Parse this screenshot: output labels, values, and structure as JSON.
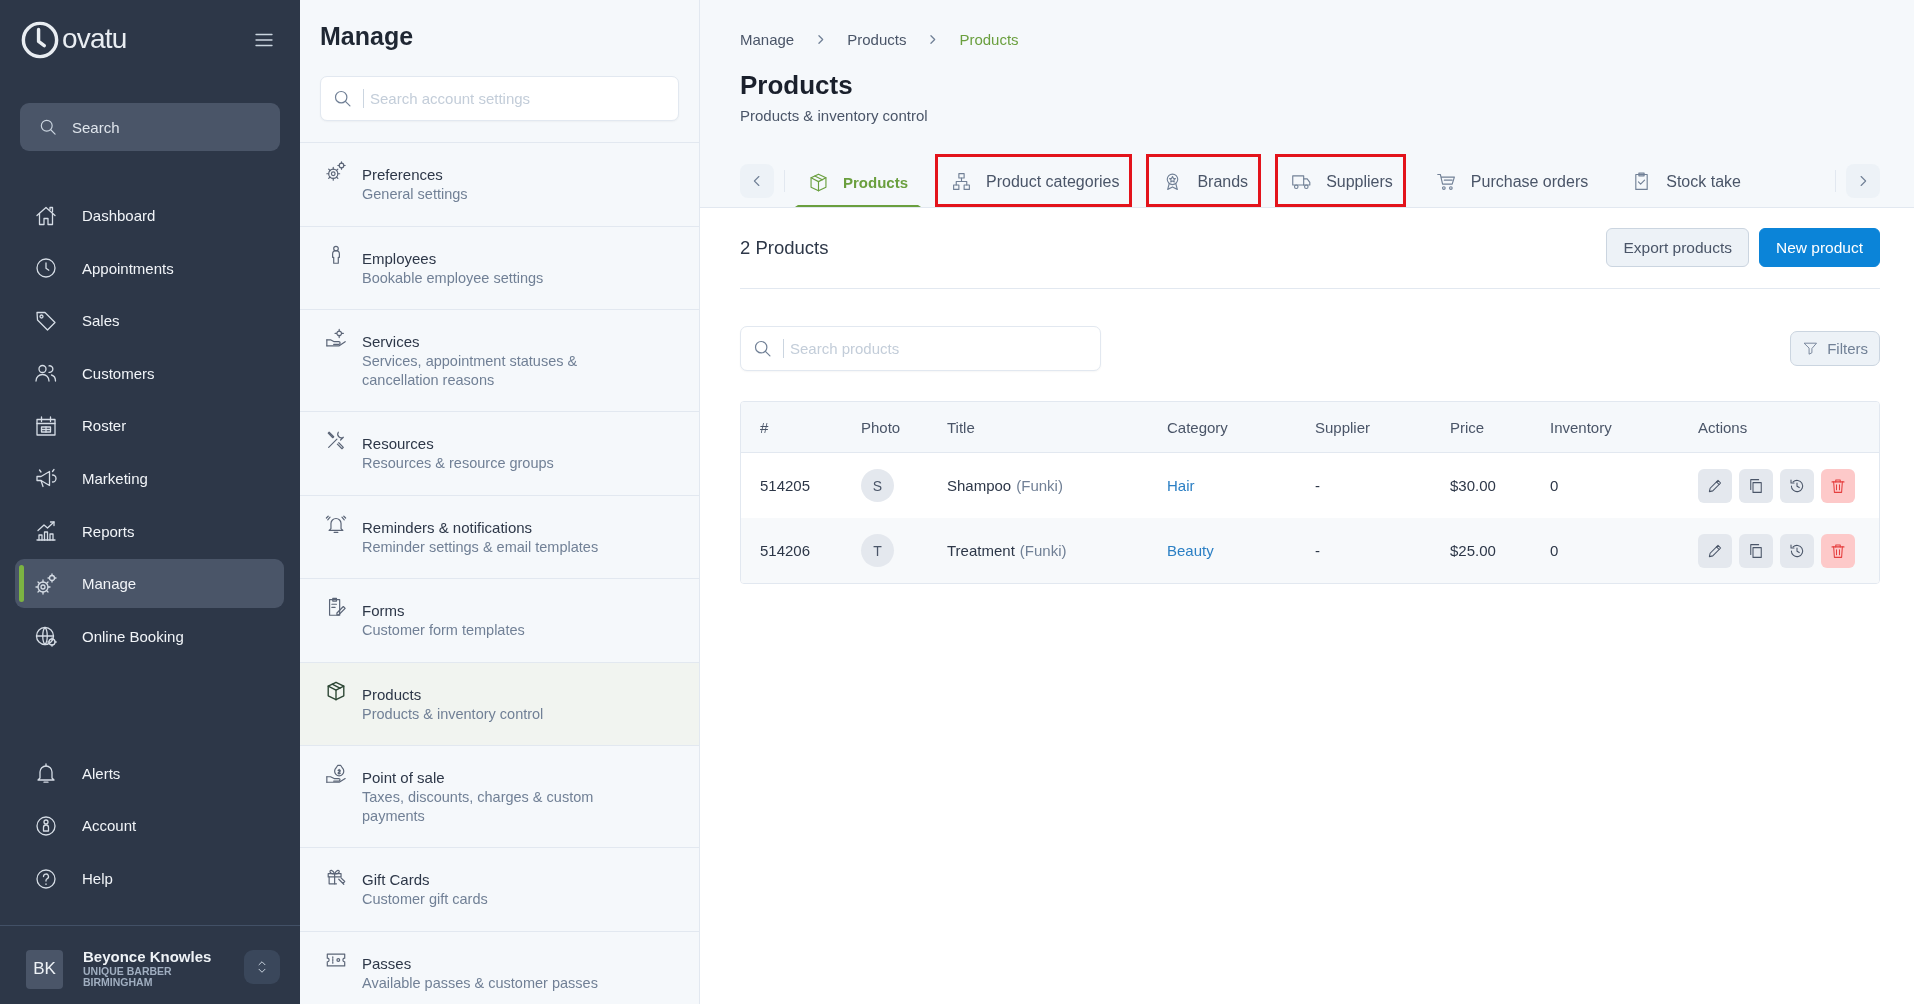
{
  "sidebar": {
    "logo": "ovatu",
    "search": {
      "placeholder": "Search"
    },
    "nav": [
      {
        "label": "Dashboard",
        "selected": false
      },
      {
        "label": "Appointments",
        "selected": false
      },
      {
        "label": "Sales",
        "selected": false
      },
      {
        "label": "Customers",
        "selected": false
      },
      {
        "label": "Roster",
        "selected": false
      },
      {
        "label": "Marketing",
        "selected": false
      },
      {
        "label": "Reports",
        "selected": false
      },
      {
        "label": "Manage",
        "selected": true
      },
      {
        "label": "Online Booking",
        "selected": false
      }
    ],
    "footer_nav": [
      {
        "label": "Alerts",
        "selected": false
      },
      {
        "label": "Account",
        "selected": false
      },
      {
        "label": "Help",
        "selected": false
      }
    ],
    "user": {
      "initials": "BK",
      "name": "Beyonce Knowles",
      "organization": "UNIQUE BARBER BIRMINGHAM"
    }
  },
  "settings_panel": {
    "title": "Manage",
    "search": {
      "placeholder": "Search account settings"
    },
    "items": [
      {
        "title": "Preferences",
        "description": "General settings",
        "selected": false
      },
      {
        "title": "Employees",
        "description": "Bookable employee settings",
        "selected": false
      },
      {
        "title": "Services",
        "description": "Services, appointment statuses & cancellation reasons",
        "selected": false
      },
      {
        "title": "Resources",
        "description": "Resources & resource groups",
        "selected": false
      },
      {
        "title": "Reminders & notifications",
        "description": "Reminder settings & email templates",
        "selected": false
      },
      {
        "title": "Forms",
        "description": "Customer form templates",
        "selected": false
      },
      {
        "title": "Products",
        "description": "Products & inventory control",
        "selected": true
      },
      {
        "title": "Point of sale",
        "description": "Taxes, discounts, charges & custom payments",
        "selected": false
      },
      {
        "title": "Gift Cards",
        "description": "Customer gift cards",
        "selected": false
      },
      {
        "title": "Passes",
        "description": "Available passes & customer passes",
        "selected": false
      }
    ]
  },
  "main": {
    "breadcrumb": [
      {
        "label": "Manage",
        "current": false
      },
      {
        "label": "Products",
        "current": false
      },
      {
        "label": "Products",
        "current": true
      }
    ],
    "title": "Products",
    "subtitle": "Products & inventory control",
    "tabs": [
      {
        "label": "Products",
        "selected": true,
        "highlighted": false
      },
      {
        "label": "Product categories",
        "selected": false,
        "highlighted": true
      },
      {
        "label": "Brands",
        "selected": false,
        "highlighted": true
      },
      {
        "label": "Suppliers",
        "selected": false,
        "highlighted": true
      },
      {
        "label": "Purchase orders",
        "selected": false,
        "highlighted": false
      },
      {
        "label": "Stock take",
        "selected": false,
        "highlighted": false
      }
    ],
    "count": "2 Products",
    "buttons": [
      {
        "label": "Export products",
        "kind": "secondary"
      },
      {
        "label": "New product",
        "kind": "primary"
      }
    ],
    "search": {
      "placeholder": "Search products"
    },
    "filters_button": "Filters",
    "table": {
      "columns": [
        "#",
        "Photo",
        "Title",
        "Category",
        "Supplier",
        "Price",
        "Inventory",
        "Actions"
      ],
      "rows": [
        {
          "number": "514205",
          "photo_initial": "S",
          "title": "Shampoo",
          "brand": "(Funki)",
          "category": "Hair",
          "supplier": "-",
          "price": "$30.00",
          "inventory": "0"
        },
        {
          "number": "514206",
          "photo_initial": "T",
          "title": "Treatment",
          "brand": "(Funki)",
          "category": "Beauty",
          "supplier": "-",
          "price": "$25.00",
          "inventory": "0"
        }
      ]
    }
  }
}
